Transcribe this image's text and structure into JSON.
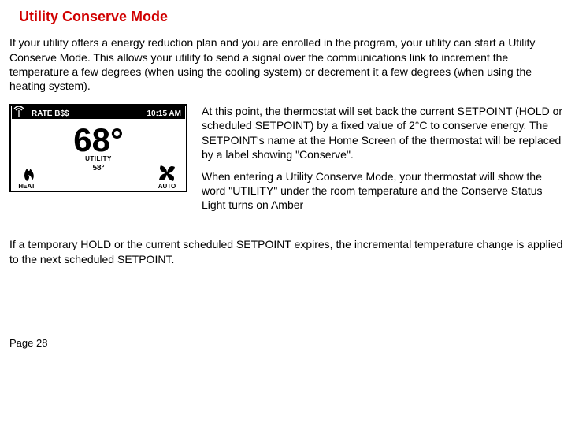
{
  "title": "Utility Conserve Mode",
  "para1": "If your utility offers a energy reduction plan and you are enrolled in the program, your utility can start a Utility Conserve Mode.  This allows your utility to send a signal over the communications link to increment the temperature a few degrees (when using the cooling system) or decrement it a few degrees (when using the heating system).",
  "para2": "At this point, the thermostat will set back the current SETPOINT (HOLD or scheduled SETPOINT) by a fixed value of 2°C to conserve energy. The SETPOINT's name at the Home Screen of the thermostat will be replaced by a label showing \"Conserve\".",
  "para3": "When entering a Utility Conserve Mode, your thermostat  will show the word \"UTILITY\" under the room temperature and the Conserve Status Light turns on Amber",
  "para4": "If a temporary HOLD or the current scheduled SETPOINT expires, the incremental temperature change is applied to the next scheduled SETPOINT.",
  "page_label": "Page 28",
  "thermo": {
    "rate": "RATE B$$",
    "time": "10:15 AM",
    "temp": "68°",
    "mode_word": "UTILITY",
    "setpoint": "58°",
    "heat": "HEAT",
    "fan": "AUTO"
  }
}
